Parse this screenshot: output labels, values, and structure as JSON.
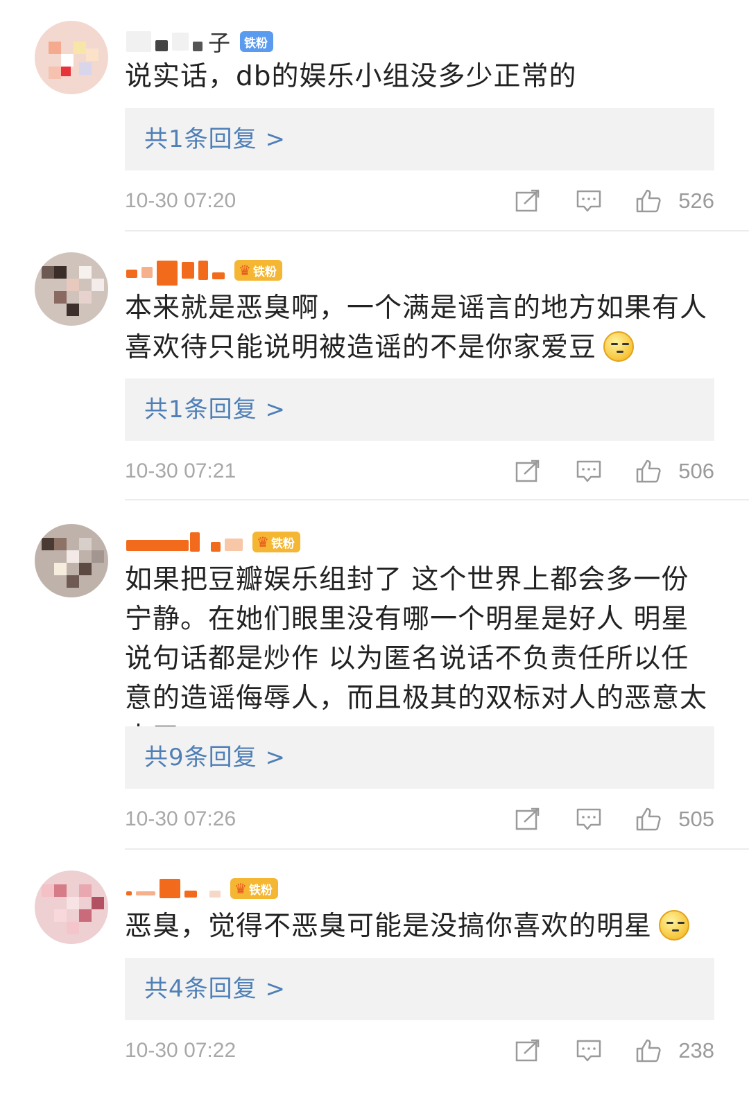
{
  "comments": [
    {
      "username_visible": "子",
      "badge": {
        "label": "铁粉",
        "style": "blue"
      },
      "text": "说实话，db的娱乐小组没多少正常的",
      "reply_link": "共1条回复 >",
      "time": "10-30 07:20",
      "likes": "526"
    },
    {
      "username_visible": "",
      "badge": {
        "label": "铁粉",
        "style": "gold",
        "level": "1"
      },
      "text": "本来就是恶臭啊，一个满是谣言的地方如果有人喜欢待只能说明被造谣的不是你家爱豆",
      "reply_link": "共1条回复 >",
      "time": "10-30 07:21",
      "likes": "506"
    },
    {
      "username_visible": "",
      "badge": {
        "label": "铁粉",
        "style": "gold",
        "level": "2"
      },
      "text": "如果把豆瓣娱乐组封了 这个世界上都会多一份宁静。在她们眼里没有哪一个明星是好人 明星说句话都是炒作 以为匿名说话不负责任所以任意的造谣侮辱人，而且极其的双标对人的恶意太大了。",
      "reply_link": "共9条回复 >",
      "time": "10-30 07:26",
      "likes": "505"
    },
    {
      "username_visible": "",
      "badge": {
        "label": "铁粉",
        "style": "gold",
        "level": "5"
      },
      "text": "恶臭，觉得不恶臭可能是没搞你喜欢的明星",
      "reply_link": "共4条回复 >",
      "time": "10-30 07:22",
      "likes": "238"
    }
  ],
  "icons": {
    "share": "share-icon",
    "comment": "comment-icon",
    "like": "thumbs-up-icon",
    "emoji": "grimace-emoji-icon"
  },
  "colors": {
    "reply_link": "#4f7fb5",
    "reply_bg": "#f2f2f2",
    "badge_blue": "#5a9bf0",
    "badge_gold": "#f5b633",
    "username_orange": "#f26b1d"
  }
}
